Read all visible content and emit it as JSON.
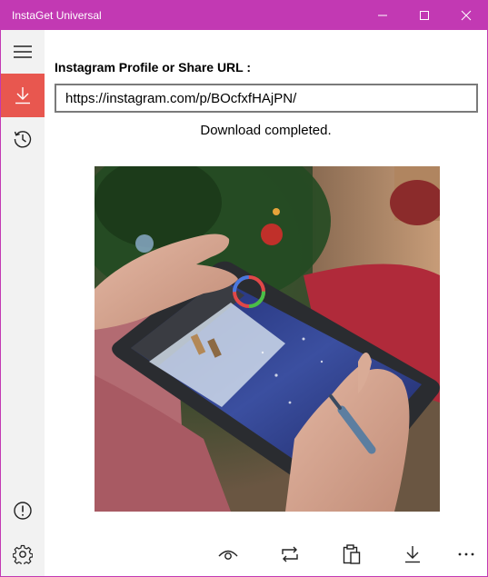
{
  "window": {
    "title": "InstaGet Universal",
    "accent_color": "#c239b3",
    "controls": [
      "minimize-icon",
      "maximize-icon",
      "close-icon"
    ]
  },
  "sidebar": {
    "items": [
      {
        "icon": "hamburger-menu-icon",
        "active": false
      },
      {
        "icon": "download-icon",
        "active": true,
        "active_color": "#e8574f"
      },
      {
        "icon": "history-icon",
        "active": false
      }
    ],
    "footer_items": [
      {
        "icon": "info-icon"
      },
      {
        "icon": "gear-icon"
      }
    ]
  },
  "main": {
    "url_label": "Instagram Profile or Share URL :",
    "url_value": "https://instagram.com/p/BOcfxfHAjPN/",
    "status": "Download completed."
  },
  "commands": [
    {
      "icon": "eye-icon"
    },
    {
      "icon": "repost-icon"
    },
    {
      "icon": "clipboard-paste-icon"
    },
    {
      "icon": "download-icon"
    },
    {
      "icon": "more-icon"
    }
  ]
}
